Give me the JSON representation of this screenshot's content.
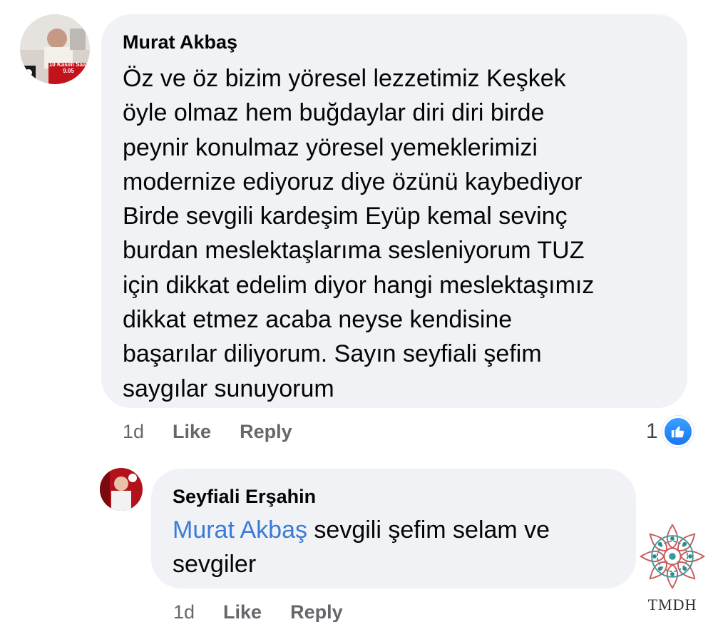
{
  "comments": [
    {
      "author": "Murat Akbaş",
      "avatar_caption": "10 Kasım Saat 9.05",
      "text": "Öz ve öz bizim yöresel lezzetimiz Keşkek\nöyle olmaz hem buğdaylar diri diri birde\npeynir konulmaz yöresel yemeklerimizi\nmodernize ediyoruz diye özünü kaybediyor\nBirde sevgili kardeşim Eyüp kemal sevinç\nburdan meslektaşlarıma sesleniyorum TUZ\niçin dikkat edelim diyor hangi meslektaşımız\ndikkat etmez acaba  neyse kendisine\nbaşarılar diliyorum. Sayın seyfiali şefim\nsaygılar sunuyorum",
      "time": "1d",
      "like_label": "Like",
      "reply_label": "Reply",
      "reaction_count": "1",
      "reaction_icon": "thumbs-up-icon"
    },
    {
      "author": "Seyfiali Erşahin",
      "mention": "Murat Akbaş",
      "text": " sevgili  şefim selam ve\nsevgiler",
      "time": "1d",
      "like_label": "Like",
      "reply_label": "Reply"
    }
  ],
  "watermark": {
    "text": "TMDH",
    "icon": "mandala-logo-icon"
  },
  "colors": {
    "bubble_bg": "#f0f2f5",
    "mention": "#3a7bd5",
    "meta": "#65676b",
    "like_blue": "#1877f2"
  }
}
